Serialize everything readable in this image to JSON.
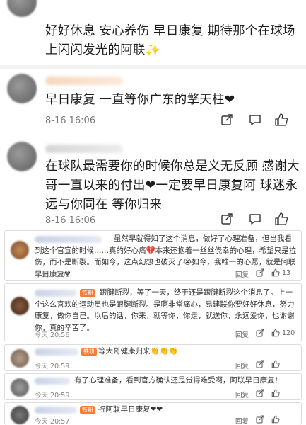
{
  "comments_big": [
    {
      "text": "好好休息 安心养伤 早日康复 期待那个在球场上闪闪发光的阿联✨",
      "time": "",
      "likes": ""
    },
    {
      "text": "早日康复 一直等你广东的擎天柱❤",
      "time": "8-16 16:06",
      "likes": ""
    },
    {
      "text": "在球队最需要你的时候你总是义无反顾 感谢大哥一直以来的付出❤一定要早日康复阿 球迷永远与你同在 等你归来",
      "time": "8-16 16:06",
      "likes": ""
    }
  ],
  "comments_small": [
    {
      "text": "虽然早就得知了这个消息，做好了心理准备，但当我看到这个官宣的时候……真的好心痛💔本来还抱着一丝丝侥幸的心理，希望只是拉伤，而不是断裂。而如今，这点幻想也破灭了😭如今，我唯一的心愿，就是阿联早日康复❤",
      "time": "今天 21:05",
      "reply": "回复",
      "likes": "13",
      "badge": ""
    },
    {
      "text": "跟腱断裂，等了一天，终于还是跟腱断裂这个消息了。上一个这么喜欢的运动员也是跟腱断裂。是啊非常痛心，易建联你要好好休息，努力康复，做你自己。以后的话，你来，就等你，你走，就送你，永远爱你，也谢谢你，真的辛苦了。",
      "time": "今天 20:56",
      "reply": "回复",
      "likes": "120",
      "badge": "铁粉"
    },
    {
      "text": "等大哥健康归来👏👏👏",
      "time": "今天 20:59",
      "reply": "回复",
      "likes": "",
      "badge": "铁粉"
    },
    {
      "text": "有了心理准备，看到官方确认还是觉得难受啊，阿联早日康复！",
      "time": "今天 20:59",
      "reply": "回复",
      "likes": "",
      "badge": ""
    },
    {
      "text": "祝阿联早日康复❤❤",
      "time": "今天 20:57",
      "reply": "回复",
      "likes": "",
      "badge": "铁粉"
    }
  ]
}
